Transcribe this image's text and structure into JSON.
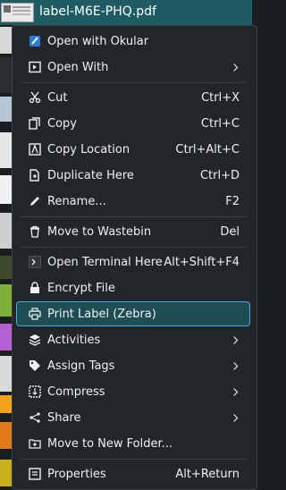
{
  "window": {
    "filename": "label-M6E-PHQ.pdf"
  },
  "menu": {
    "groups": [
      [
        {
          "label": "Open with Okular",
          "icon": "okular-icon",
          "submenu": false
        },
        {
          "label": "Open With",
          "icon": "open-with-icon",
          "submenu": true
        }
      ],
      [
        {
          "label": "Cut",
          "icon": "cut-icon",
          "shortcut": "Ctrl+X"
        },
        {
          "label": "Copy",
          "icon": "copy-icon",
          "shortcut": "Ctrl+C"
        },
        {
          "label": "Copy Location",
          "icon": "copy-location-icon",
          "shortcut": "Ctrl+Alt+C"
        },
        {
          "label": "Duplicate Here",
          "icon": "duplicate-icon",
          "shortcut": "Ctrl+D"
        },
        {
          "label": "Rename...",
          "icon": "rename-icon",
          "shortcut": "F2"
        }
      ],
      [
        {
          "label": "Move to Wastebin",
          "icon": "trash-icon",
          "shortcut": "Del"
        }
      ],
      [
        {
          "label": "Open Terminal Here",
          "icon": "terminal-icon",
          "shortcut": "Alt+Shift+F4"
        },
        {
          "label": "Encrypt File",
          "icon": "lock-icon"
        },
        {
          "label": "Print Label (Zebra)",
          "icon": "printer-icon",
          "highlighted": true
        },
        {
          "label": "Activities",
          "icon": "activities-icon",
          "submenu": true
        },
        {
          "label": "Assign Tags",
          "icon": "tag-icon",
          "submenu": true
        },
        {
          "label": "Compress",
          "icon": "compress-icon",
          "submenu": true
        },
        {
          "label": "Share",
          "icon": "share-icon",
          "submenu": true
        },
        {
          "label": "Move to New Folder...",
          "icon": "new-folder-icon"
        }
      ],
      [
        {
          "label": "Properties",
          "icon": "properties-icon",
          "shortcut": "Alt+Return"
        }
      ]
    ]
  },
  "colors": {
    "accent": "#3daee9",
    "highlight": "#1e4e53",
    "menu_bg": "#232629",
    "titlebar": "#1f5b62"
  }
}
